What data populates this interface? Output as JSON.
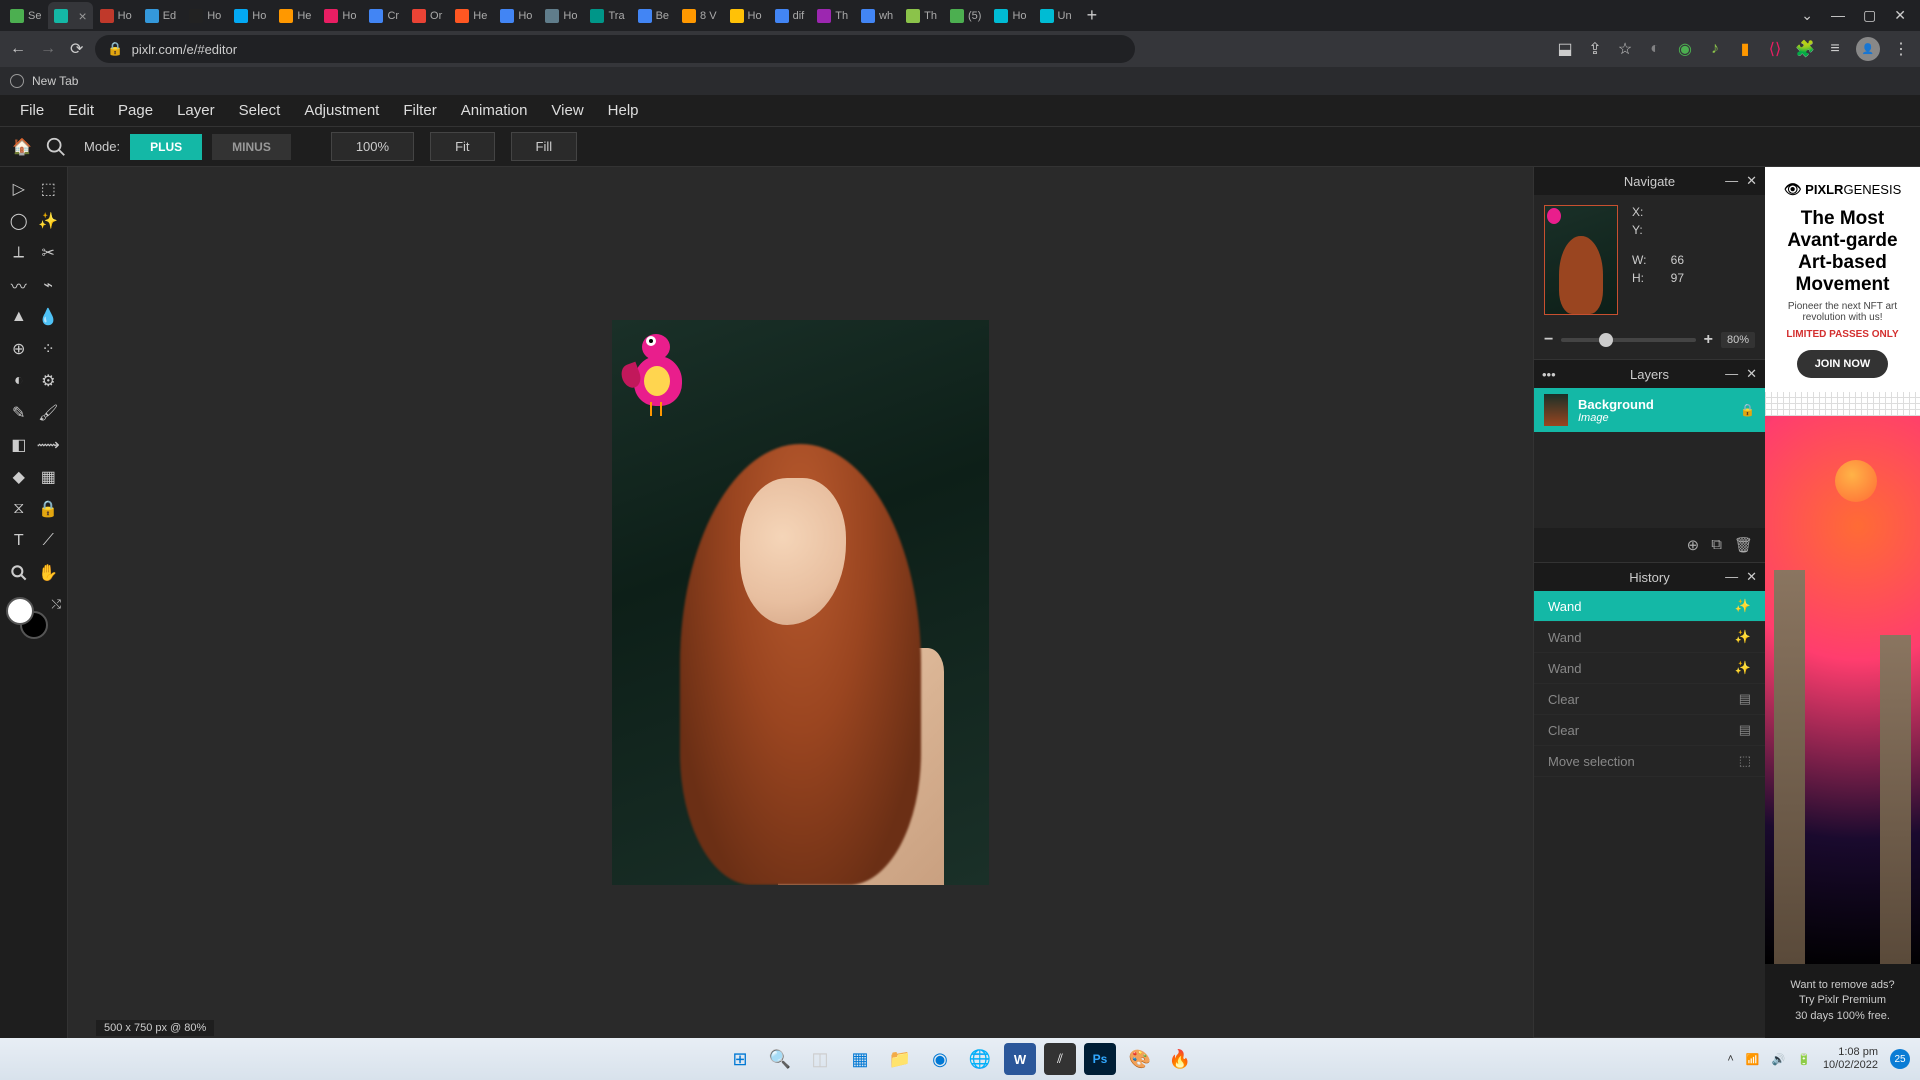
{
  "browser": {
    "tabs": [
      {
        "label": "Se",
        "favicon": "#4caf50"
      },
      {
        "label": "",
        "favicon": "#14b8a6",
        "active": true
      },
      {
        "label": "Ho",
        "favicon": "#c0392b"
      },
      {
        "label": "Ed",
        "favicon": "#3498db"
      },
      {
        "label": "Ho",
        "favicon": "#222"
      },
      {
        "label": "Ho",
        "favicon": "#03a9f4"
      },
      {
        "label": "He",
        "favicon": "#ff9800"
      },
      {
        "label": "Ho",
        "favicon": "#e91e63"
      },
      {
        "label": "Cr",
        "favicon": "#4285f4"
      },
      {
        "label": "Or",
        "favicon": "#ea4335"
      },
      {
        "label": "He",
        "favicon": "#ff5722"
      },
      {
        "label": "Ho",
        "favicon": "#4285f4"
      },
      {
        "label": "Ho",
        "favicon": "#607d8b"
      },
      {
        "label": "Tra",
        "favicon": "#009688"
      },
      {
        "label": "Be",
        "favicon": "#4285f4"
      },
      {
        "label": "8 V",
        "favicon": "#ff9800"
      },
      {
        "label": "Ho",
        "favicon": "#ffc107"
      },
      {
        "label": "dif",
        "favicon": "#4285f4"
      },
      {
        "label": "Th",
        "favicon": "#9c27b0"
      },
      {
        "label": "wh",
        "favicon": "#4285f4"
      },
      {
        "label": "Th",
        "favicon": "#8bc34a"
      },
      {
        "label": "(5)",
        "favicon": "#4caf50"
      },
      {
        "label": "Ho",
        "favicon": "#00bcd4"
      },
      {
        "label": "Un",
        "favicon": "#00bcd4"
      }
    ],
    "url": "pixlr.com/e/#editor",
    "bookmark": "New Tab"
  },
  "menubar": [
    "File",
    "Edit",
    "Page",
    "Layer",
    "Select",
    "Adjustment",
    "Filter",
    "Animation",
    "View",
    "Help"
  ],
  "options": {
    "mode_label": "Mode:",
    "plus": "PLUS",
    "minus": "MINUS",
    "pct": "100%",
    "fit": "Fit",
    "fill": "Fill"
  },
  "canvas": {
    "info": "500 x 750 px @ 80%"
  },
  "navigate": {
    "title": "Navigate",
    "x_label": "X:",
    "y_label": "Y:",
    "w_label": "W:",
    "h_label": "H:",
    "w_val": "66",
    "h_val": "97",
    "zoom": "80%"
  },
  "layers": {
    "title": "Layers",
    "item_name": "Background",
    "item_type": "Image"
  },
  "history": {
    "title": "History",
    "items": [
      {
        "label": "Wand",
        "active": true,
        "icon": "wand"
      },
      {
        "label": "Wand",
        "icon": "wand"
      },
      {
        "label": "Wand",
        "icon": "wand"
      },
      {
        "label": "Clear",
        "icon": "doc"
      },
      {
        "label": "Clear",
        "icon": "doc"
      },
      {
        "label": "Move selection",
        "icon": "sel"
      }
    ]
  },
  "ad": {
    "logo_brand": "PIXLR",
    "logo_sub": "GENESIS",
    "headline": "The Most Avant-garde Art-based Movement",
    "sub": "Pioneer the next NFT art revolution with us!",
    "limited": "LIMITED PASSES ONLY",
    "cta": "JOIN NOW",
    "bottom1": "Want to remove ads?",
    "bottom2": "Try Pixlr Premium",
    "bottom3": "30 days 100% free."
  },
  "taskbar": {
    "time": "1:08 pm",
    "date": "10/02/2022",
    "notif": "25"
  }
}
